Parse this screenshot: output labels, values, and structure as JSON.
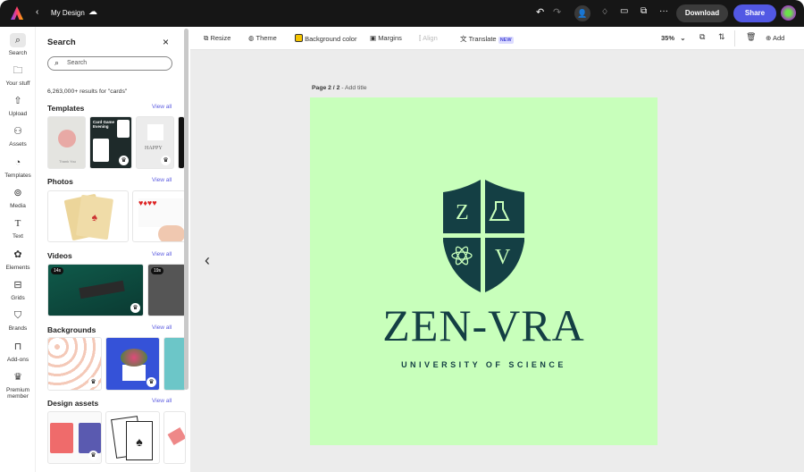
{
  "header": {
    "title": "My Design",
    "download": "Download",
    "share": "Share"
  },
  "toolbar": {
    "resize": "Resize",
    "theme": "Theme",
    "background_color": "Background color",
    "margins": "Margins",
    "align": "Align",
    "translate": "Translate",
    "new_badge": "NEW",
    "zoom": "35%",
    "add": "Add"
  },
  "colors": {
    "accent": "#5c5ce0",
    "page_bg": "#c8ffbb",
    "logo": "#143f44",
    "bg_swatch": "#f5c400"
  },
  "rail": [
    {
      "label": "Search"
    },
    {
      "label": "Your stuff"
    },
    {
      "label": "Upload"
    },
    {
      "label": "Assets"
    },
    {
      "label": "Templates"
    },
    {
      "label": "Media"
    },
    {
      "label": "Text"
    },
    {
      "label": "Elements"
    },
    {
      "label": "Grids"
    },
    {
      "label": "Brands"
    },
    {
      "label": "Add-ons"
    },
    {
      "label": "Premium member"
    }
  ],
  "panel": {
    "title": "Search",
    "search_placeholder": "Search",
    "results": "6,263,000+ results for \"cards\"",
    "sections": [
      {
        "title": "Templates",
        "view_all": "View all"
      },
      {
        "title": "Photos",
        "view_all": "View all"
      },
      {
        "title": "Videos",
        "view_all": "View all"
      },
      {
        "title": "Backgrounds",
        "view_all": "View all"
      },
      {
        "title": "Design assets",
        "view_all": "View all"
      }
    ],
    "template_texts": {
      "card_game": "Card Game Evening",
      "happy": "HAPPY",
      "thank_you": "Thank You"
    },
    "videos": [
      {
        "duration": "14s"
      },
      {
        "duration": "19s"
      }
    ]
  },
  "page": {
    "label": "Page 2 / 2",
    "add_title": "- Add title",
    "logo_z": "Z",
    "logo_v": "V",
    "brand": "ZEN-VRA",
    "tagline": "UNIVERSITY OF SCIENCE"
  }
}
